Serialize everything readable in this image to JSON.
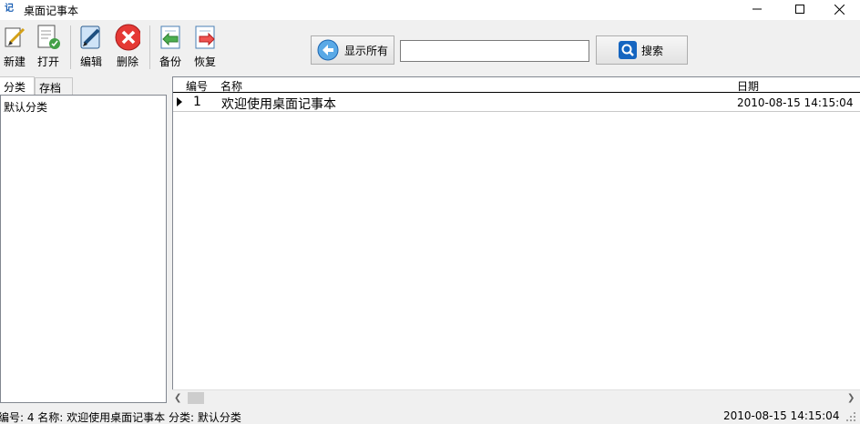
{
  "window": {
    "icon_char": "记",
    "title": "桌面记事本"
  },
  "toolbar": {
    "new_label": "新建",
    "open_label": "打开",
    "edit_label": "编辑",
    "delete_label": "删除",
    "backup_label": "备份",
    "restore_label": "恢复",
    "show_all_label": "显示所有",
    "search_value": "",
    "search_label": "搜索"
  },
  "sidebar": {
    "tabs": [
      {
        "label": "分类"
      },
      {
        "label": "存档"
      }
    ],
    "items": [
      "默认分类"
    ]
  },
  "grid": {
    "columns": [
      "编号",
      "名称",
      "日期"
    ],
    "rows": [
      {
        "id": "1",
        "name": "欢迎使用桌面记事本",
        "date": "2010-08-15 14:15:04"
      }
    ]
  },
  "statusbar": {
    "left": "编号: 4  名称: 欢迎使用桌面记事本  分类: 默认分类",
    "right": "2010-08-15 14:15:04"
  },
  "colors": {
    "delete_red": "#e53935",
    "search_blue": "#1565c0",
    "show_all_blue": "#1e88e5"
  }
}
